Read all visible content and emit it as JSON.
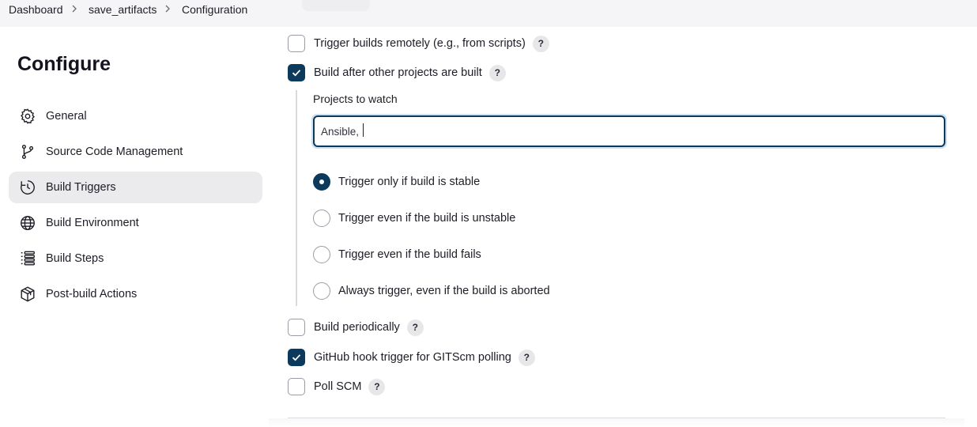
{
  "breadcrumb": {
    "items": [
      "Dashboard",
      "save_artifacts",
      "Configuration"
    ]
  },
  "sidebar": {
    "title": "Configure",
    "items": [
      {
        "label": "General",
        "icon": "gear-icon",
        "active": false
      },
      {
        "label": "Source Code Management",
        "icon": "git-branch-icon",
        "active": false
      },
      {
        "label": "Build Triggers",
        "icon": "clock-icon",
        "active": true
      },
      {
        "label": "Build Environment",
        "icon": "globe-icon",
        "active": false
      },
      {
        "label": "Build Steps",
        "icon": "list-icon",
        "active": false
      },
      {
        "label": "Post-build Actions",
        "icon": "package-icon",
        "active": false
      }
    ]
  },
  "triggers": {
    "remote": {
      "label": "Trigger builds remotely (e.g., from scripts)",
      "checked": false
    },
    "after_other": {
      "label": "Build after other projects are built",
      "checked": true
    },
    "projects_to_watch": {
      "label": "Projects to watch",
      "value": "Ansible,"
    },
    "radio_options": [
      {
        "label": "Trigger only if build is stable",
        "selected": true
      },
      {
        "label": "Trigger even if the build is unstable",
        "selected": false
      },
      {
        "label": "Trigger even if the build fails",
        "selected": false
      },
      {
        "label": "Always trigger, even if the build is aborted",
        "selected": false
      }
    ],
    "periodically": {
      "label": "Build periodically",
      "checked": false
    },
    "github_hook": {
      "label": "GitHub hook trigger for GITScm polling",
      "checked": true
    },
    "poll_scm": {
      "label": "Poll SCM",
      "checked": false
    },
    "help_glyph": "?"
  },
  "colors": {
    "accent": "#0b3a5c",
    "active_bg": "#ebebee",
    "breadcrumb_bg": "#f5f5f7"
  }
}
